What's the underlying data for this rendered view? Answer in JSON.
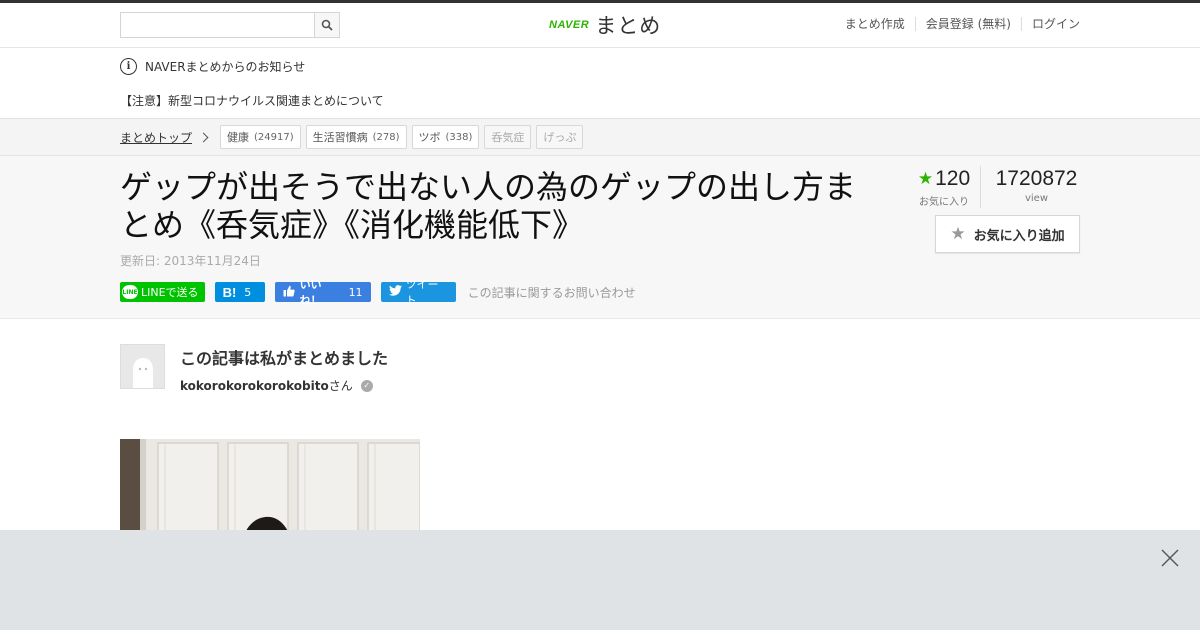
{
  "header": {
    "search": {
      "placeholder": "",
      "value": ""
    },
    "logo": {
      "brand": "NAVER",
      "product": "まとめ"
    },
    "nav": [
      {
        "label": "まとめ作成"
      },
      {
        "label": "会員登録 (無料)"
      },
      {
        "label": "ログイン"
      }
    ]
  },
  "notice": {
    "title": "NAVERまとめからのお知らせ",
    "link": "【注意】新型コロナウイルス関連まとめについて"
  },
  "breadcrumb": {
    "top": "まとめトップ",
    "tags": [
      {
        "label": "健康",
        "count": "(24917)"
      },
      {
        "label": "生活習慣病",
        "count": "(278)"
      },
      {
        "label": "ツボ",
        "count": "(338)"
      },
      {
        "label": "呑気症",
        "count": ""
      },
      {
        "label": "げっぷ",
        "count": ""
      }
    ]
  },
  "article": {
    "title": "ゲップが出そうで出ない人の為のゲップの出し方まとめ《呑気症》《消化機能低下》",
    "updated": "更新日: 2013年11月24日",
    "share": {
      "line": "LINEで送る",
      "hatena_icon": "B!",
      "hatena_count": "5",
      "fb_label": "いいね！",
      "fb_count": "11",
      "tweet": "ツイート",
      "contact": "この記事に関するお問い合わせ"
    },
    "stats": {
      "fav_count": "120",
      "fav_label": "お気に入り",
      "view_count": "1720872",
      "view_label": "view"
    },
    "fav_button": "お気に入り追加"
  },
  "author": {
    "heading": "この記事は私がまとめました",
    "name": "kokorokorokorokobito",
    "suffix": "さん"
  },
  "colors": {
    "brand_green": "#2db400",
    "line_green": "#00c300",
    "hatena_blue": "#008fde",
    "facebook_blue": "#3b7fe0",
    "twitter_blue": "#1b95e0"
  }
}
